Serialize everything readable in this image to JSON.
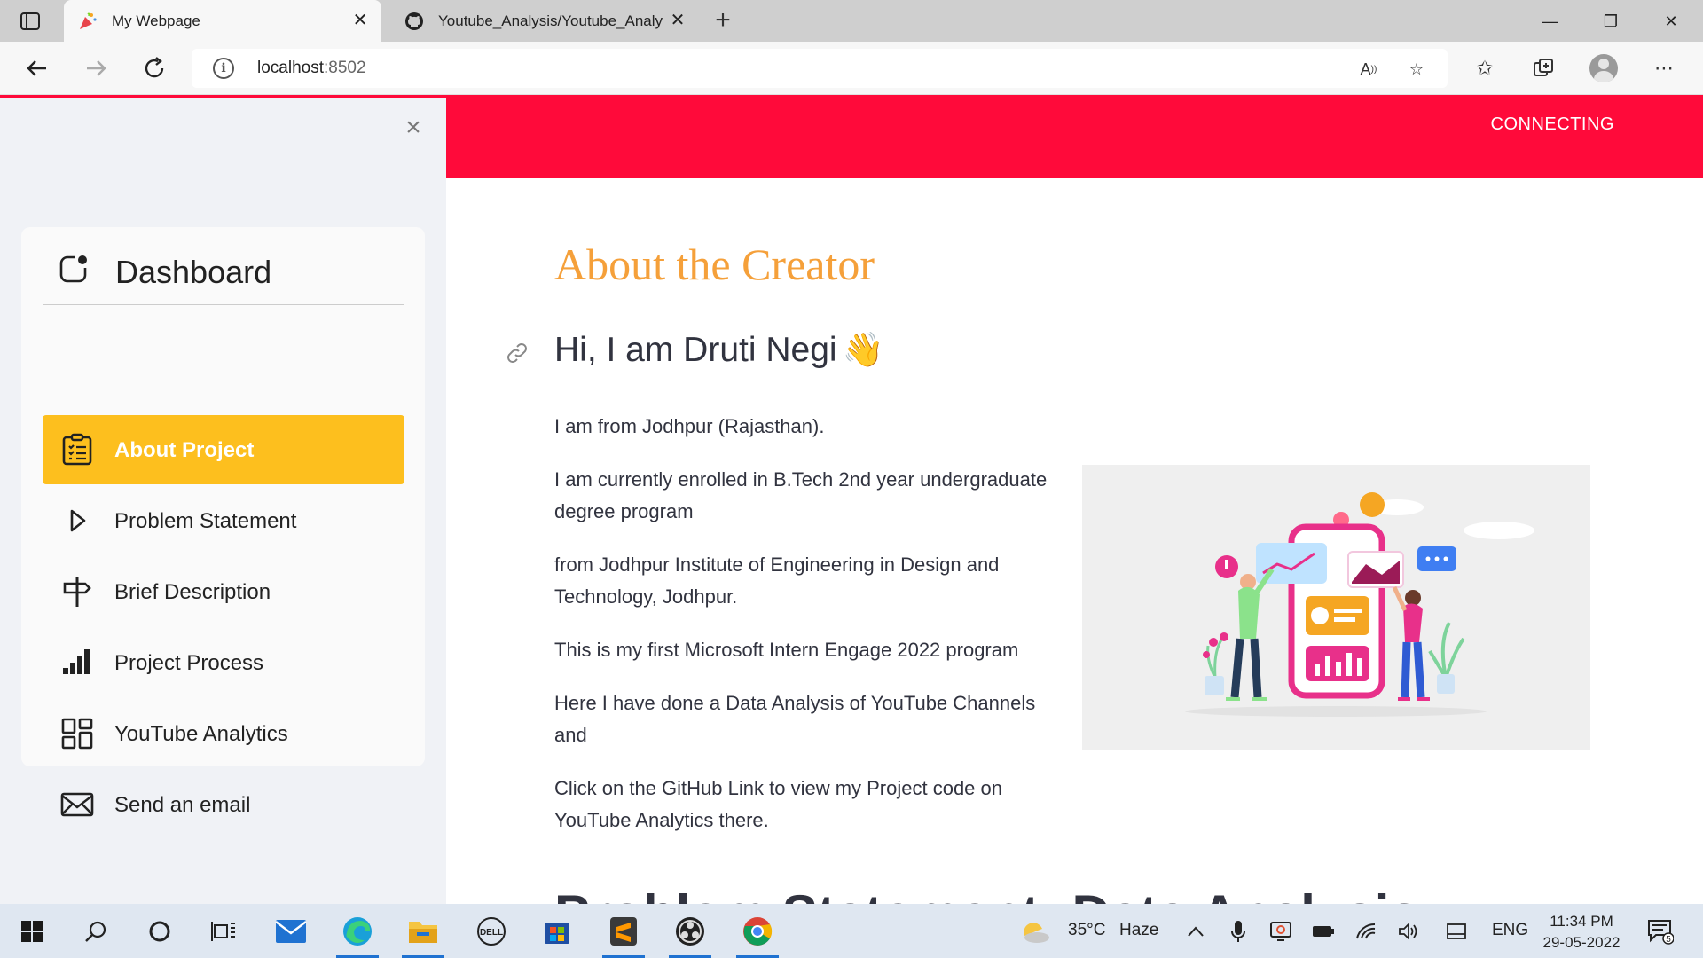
{
  "browser": {
    "tabs": [
      {
        "title": "My Webpage",
        "active": true
      },
      {
        "title": "Youtube_Analysis/Youtube_Analy",
        "active": false
      }
    ],
    "new_tab": "+",
    "window_controls": {
      "minimize": "—",
      "restore": "❐",
      "close": "✕"
    },
    "address": {
      "host": "localhost",
      "port": ":8502"
    }
  },
  "sidebar": {
    "close": "×",
    "title": "Dashboard",
    "items": [
      {
        "label": "About Project",
        "icon": "clipboard-list-icon",
        "active": true
      },
      {
        "label": "Problem Statement",
        "icon": "play-outline-icon",
        "active": false
      },
      {
        "label": "Brief Description",
        "icon": "signpost-icon",
        "active": false
      },
      {
        "label": "Project Process",
        "icon": "signal-bars-icon",
        "active": false
      },
      {
        "label": "YouTube Analytics",
        "icon": "grid-icon",
        "active": false
      },
      {
        "label": "Send an email",
        "icon": "envelope-icon",
        "active": false
      }
    ]
  },
  "header": {
    "status": "CONNECTING"
  },
  "main": {
    "title": "About the Creator",
    "greeting": "Hi, I am Druti Negi",
    "greeting_emoji": "👋",
    "paragraphs": [
      "I am from Jodhpur (Rajasthan).",
      "I am currently enrolled in B.Tech 2nd year undergraduate degree program",
      "from Jodhpur Institute of Engineering in Design and Technology, Jodhpur.",
      "This is my first Microsoft Intern Engage 2022 program",
      "Here I have done a Data Analysis of YouTube Channels and",
      "Click on the GitHub Link to view my Project code on YouTube Analytics there."
    ],
    "next_heading_partial": "Problem Statement: Data Analysis"
  },
  "taskbar": {
    "weather": {
      "temp": "35°C",
      "condition": "Haze"
    },
    "language": "ENG",
    "time": "11:34 PM",
    "date": "29-05-2022",
    "notification_count": "5"
  },
  "colors": {
    "accent_red": "#ff0a3a",
    "active_menu": "#fdbf1e",
    "title_orange": "#f5a03a",
    "sidebar_bg": "#f0f2f6"
  }
}
